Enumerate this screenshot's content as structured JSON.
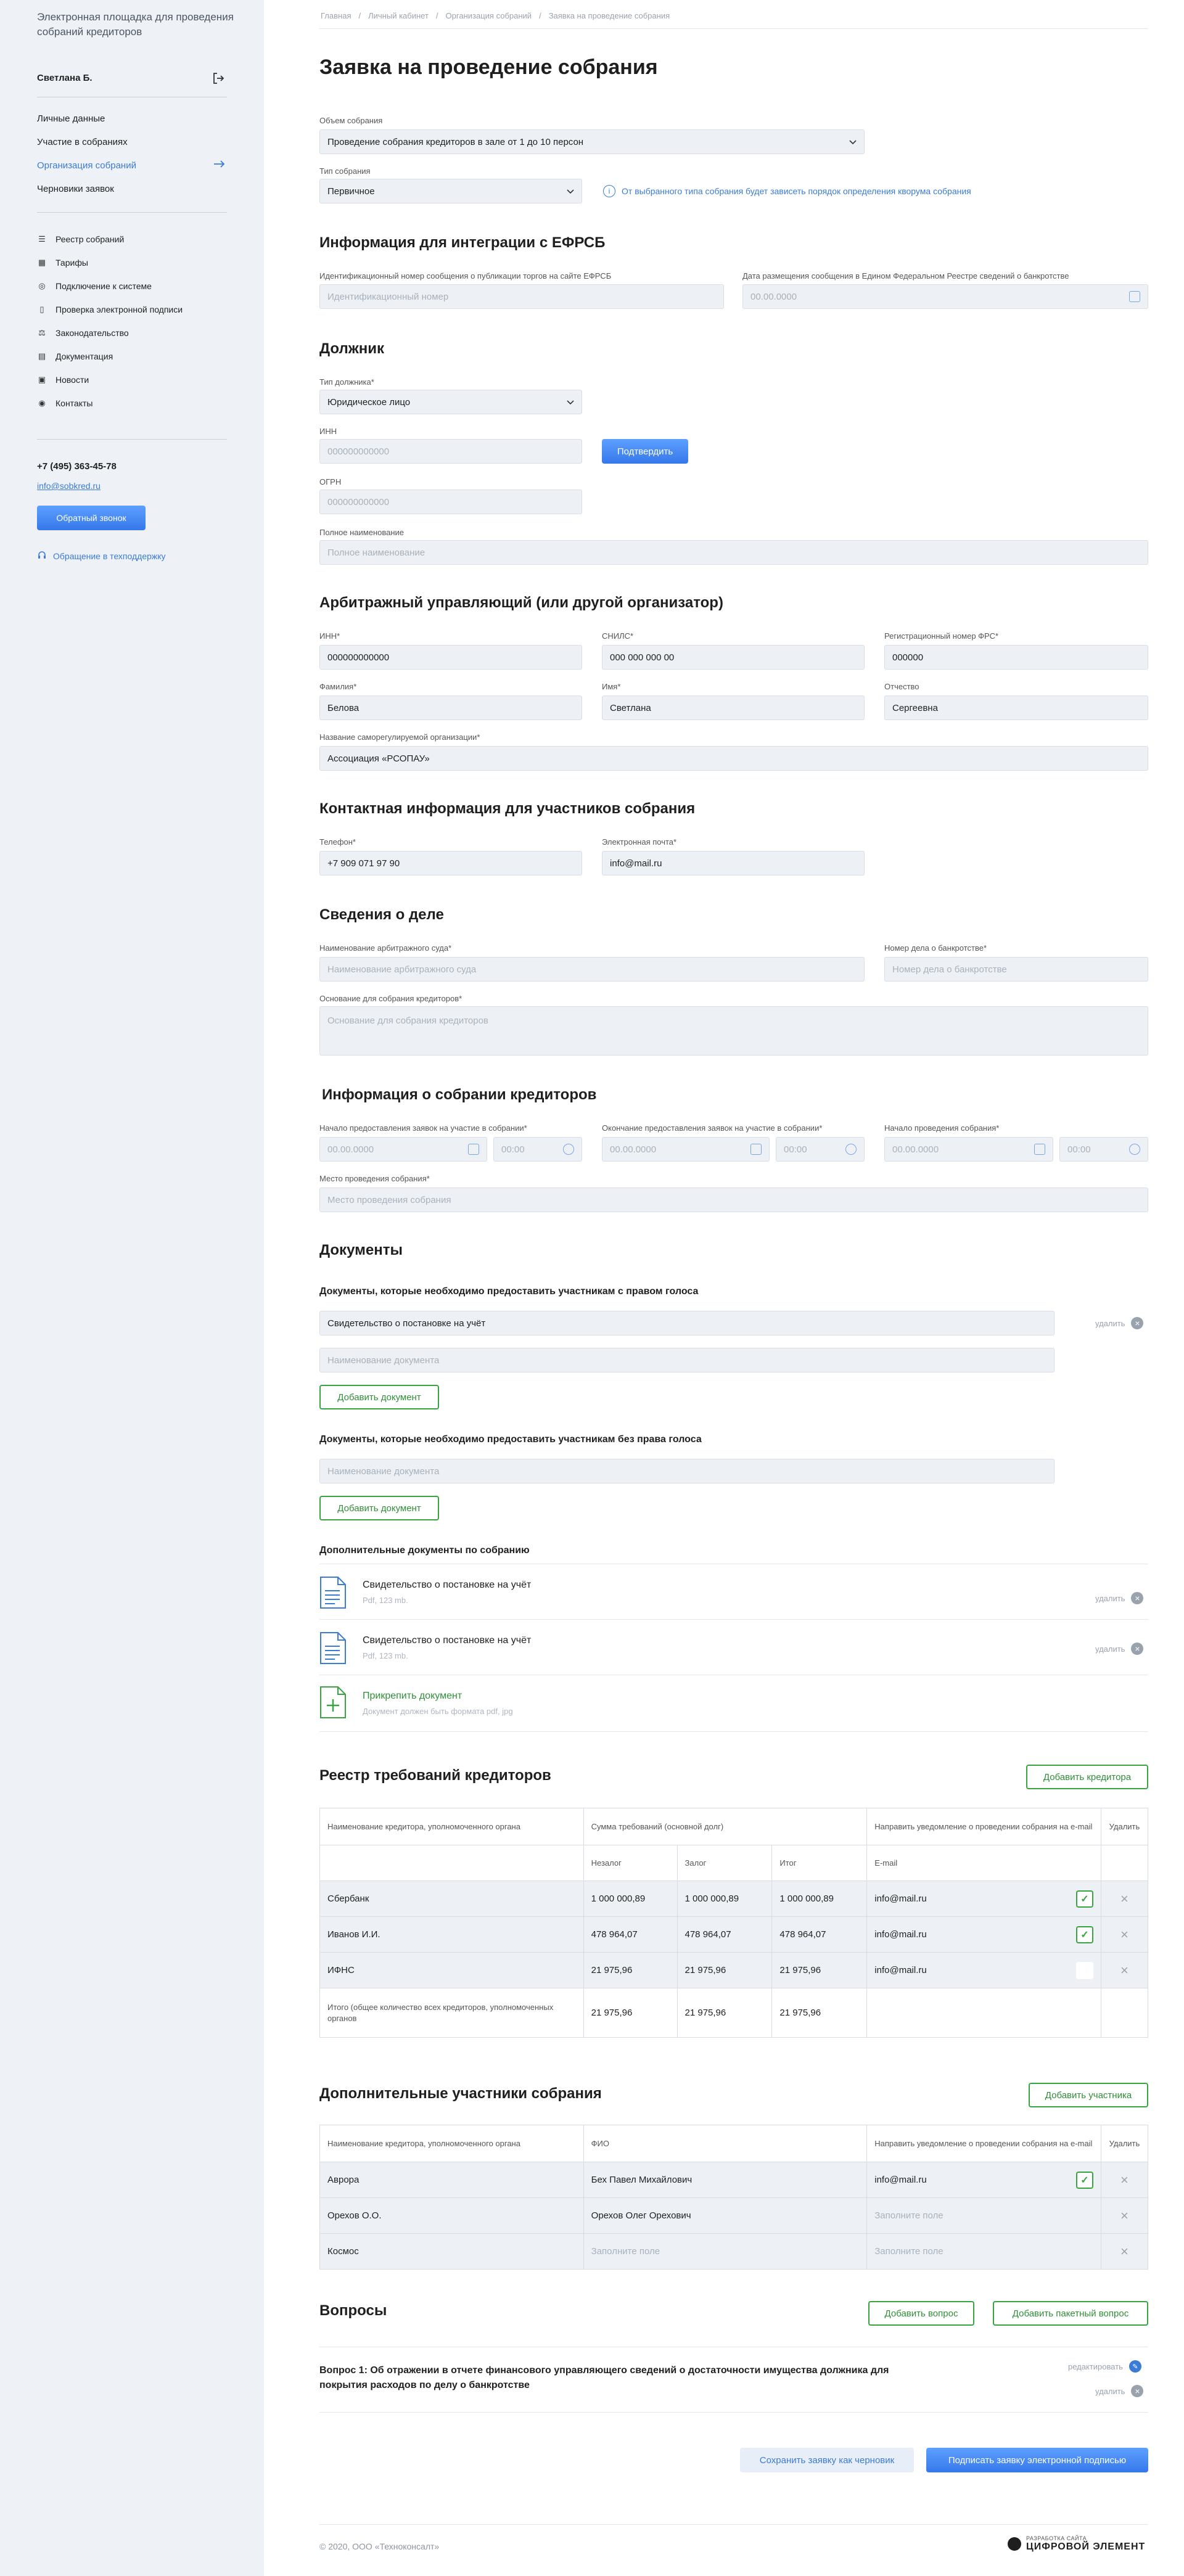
{
  "sidebar": {
    "brand": "Электронная площадка для проведения собраний кредиторов",
    "user_name": "Светлана Б.",
    "nav": [
      "Личные данные",
      "Участие в собраниях",
      "Организация собраний",
      "Черновики заявок"
    ],
    "active_index": 2,
    "sub_nav": [
      {
        "label": "Реестр собраний",
        "icon": "list-icon"
      },
      {
        "label": "Тарифы",
        "icon": "tariff-icon"
      },
      {
        "label": "Подключение к системе",
        "icon": "connect-icon"
      },
      {
        "label": "Проверка электронной подписи",
        "icon": "signature-icon"
      },
      {
        "label": "Законодательство",
        "icon": "law-icon"
      },
      {
        "label": "Документация",
        "icon": "docs-icon"
      },
      {
        "label": "Новости",
        "icon": "news-icon"
      },
      {
        "label": "Контакты",
        "icon": "contacts-icon"
      }
    ],
    "phone": "+7 (495) 363-45-78",
    "email": "info@sobkred.ru",
    "callback_btn": "Обратный звонок",
    "support": "Обращение в техподдержку"
  },
  "breadcrumb": [
    "Главная",
    "/",
    "Личный кабинет",
    "/",
    "Организация собраний",
    "/",
    "Заявка на проведение собрания"
  ],
  "page_title": "Заявка на проведение собрания",
  "meeting": {
    "volume_label": "Объем собрания",
    "volume_value": "Проведение собрания кредиторов в зале от 1 до 10 персон",
    "type_label": "Тип собрания",
    "type_value": "Первичное",
    "hint": "От выбранного типа собрания будет зависеть порядок определения кворума собрания"
  },
  "efrsb": {
    "title": "Информация для интеграции с ЕФРСБ",
    "id_label": "Идентификационный номер сообщения о публикации торгов на сайте ЕФРСБ",
    "id_placeholder": "Идентификационный номер",
    "date_label": "Дата размещения сообщения в Едином Федеральном Реестре сведений о банкротстве",
    "date_placeholder": "00.00.0000"
  },
  "debtor": {
    "title": "Должник",
    "type_label": "Тип должника*",
    "type_value": "Юридическое лицо",
    "inn_label": "ИНН",
    "inn_placeholder": "000000000000",
    "confirm_btn": "Подтвердить",
    "ogrn_label": "ОГРН",
    "ogrn_placeholder": "000000000000",
    "fullname_label": "Полное наименование",
    "fullname_placeholder": "Полное наименование"
  },
  "manager": {
    "title": "Арбитражный управляющий (или другой организатор)",
    "inn_label": "ИНН*",
    "inn_value": "000000000000",
    "snils_label": "СНИЛС*",
    "snils_value": "000 000 000 00",
    "reg_label": "Регистрационный номер ФРС*",
    "reg_value": "000000",
    "last_label": "Фамилия*",
    "last_value": "Белова",
    "first_label": "Имя*",
    "first_value": "Светлана",
    "mid_label": "Отчество",
    "mid_value": "Сергеевна",
    "sro_label": "Название саморегулируемой организации*",
    "sro_value": "Ассоциация «РСОПАУ»"
  },
  "contact": {
    "title": "Контактная информация для участников собрания",
    "phone_label": "Телефон*",
    "phone_value": "+7 909 071 97 90",
    "email_label": "Электронная почта*",
    "email_value": "info@mail.ru"
  },
  "case": {
    "title": "Сведения о деле",
    "court_label": "Наименование арбитражного суда*",
    "court_placeholder": "Наименование арбитражного суда",
    "num_label": "Номер дела о банкротстве*",
    "num_placeholder": "Номер дела о банкротстве",
    "basis_label": "Основание для собрания кредиторов*",
    "basis_placeholder": "Основание для собрания кредиторов"
  },
  "info": {
    "title": "Информация о собрании кредиторов",
    "start_label": "Начало предоставления заявок на участие в собрании*",
    "end_label": "Окончание предоставления заявок на участие в собрании*",
    "meet_label": "Начало проведения собрания*",
    "date_ph": "00.00.0000",
    "time_ph": "00:00",
    "place_label": "Место проведения собрания*",
    "place_placeholder": "Место проведения собрания"
  },
  "documents": {
    "title": "Документы",
    "voting_title": "Документы, которые необходимо предоставить участникам с правом голоса",
    "voting_doc": "Свидетельство о постановке на учёт",
    "doc_placeholder": "Наименование документа",
    "delete": "удалить",
    "add_doc": "Добавить документ",
    "nonvoting_title": "Документы, которые необходимо предоставить участникам без права голоса",
    "extra_title": "Дополнительные документы по собранию",
    "files": [
      {
        "name": "Свидетельство о постановке на учёт",
        "meta": "Pdf, 123 mb."
      },
      {
        "name": "Свидетельство о постановке на учёт",
        "meta": "Pdf, 123 mb."
      }
    ],
    "attach": "Прикрепить документ",
    "attach_hint": "Документ должен быть формата pdf, jpg"
  },
  "registry": {
    "title": "Реестр требований кредиторов",
    "add_btn": "Добавить кредитора",
    "headers": [
      "Наименование кредитора, уполномоченного органа",
      "Сумма требований (основной долг)",
      "Направить уведомление о проведении собрания на e-mail",
      "Удалить"
    ],
    "sub_headers": [
      "Незалог",
      "Залог",
      "Итог",
      "E-mail"
    ],
    "rows": [
      {
        "name": "Сбербанк",
        "a": "1 000 000,89",
        "b": "1 000 000,89",
        "c": "1 000 000,89",
        "email": "info@mail.ru",
        "checked": true
      },
      {
        "name": "Иванов И.И.",
        "a": "478 964,07",
        "b": "478 964,07",
        "c": "478 964,07",
        "email": "info@mail.ru",
        "checked": true
      },
      {
        "name": "ИФНС",
        "a": "21 975,96",
        "b": "21 975,96",
        "c": "21 975,96",
        "email": "info@mail.ru",
        "checked": false
      }
    ],
    "total": {
      "name": "Итого (общее количество всех кредиторов, уполномоченных органов",
      "a": "21 975,96",
      "b": "21 975,96",
      "c": "21 975,96"
    }
  },
  "participants": {
    "title": "Дополнительные участники собрания",
    "add_btn": "Добавить участника",
    "headers": [
      "Наименование кредитора, уполномоченного органа",
      "ФИО",
      "Направить уведомление о проведении собрания на e-mail",
      "Удалить"
    ],
    "fill_ph": "Заполните поле",
    "rows": [
      {
        "name": "Аврора",
        "fio": "Бех Павел Михайлович",
        "email": "info@mail.ru",
        "checked": true
      },
      {
        "name": "Орехов О.О.",
        "fio": "Орехов Олег Орехович",
        "email": "",
        "checked": false
      },
      {
        "name": "Космос",
        "fio": "",
        "email": "",
        "checked": false
      }
    ]
  },
  "questions": {
    "title": "Вопросы",
    "add_btn": "Добавить вопрос",
    "add_batch_btn": "Добавить пакетный вопрос",
    "q1": "Вопрос 1: Об отражении в отчете финансового управляющего сведений о достаточности имущества должника для покрытия расходов по делу о банкротстве",
    "edit": "редактировать",
    "delete": "удалить"
  },
  "actions": {
    "save_draft": "Сохранить заявку как черновик",
    "sign": "Подписать заявку электронной подписью"
  },
  "footer": {
    "copyright": "© 2020, ООО «Техноконсалт»",
    "dev_small": "РАЗРАБОТКА САЙТА",
    "dev_name": "ЦИФРОВОЙ ЭЛЕМЕНТ"
  },
  "colors": {
    "accent": "#3a7bd5",
    "green": "#3aa341",
    "sidebar_bg": "#eef2f7",
    "input_bg": "#edf1f5"
  }
}
